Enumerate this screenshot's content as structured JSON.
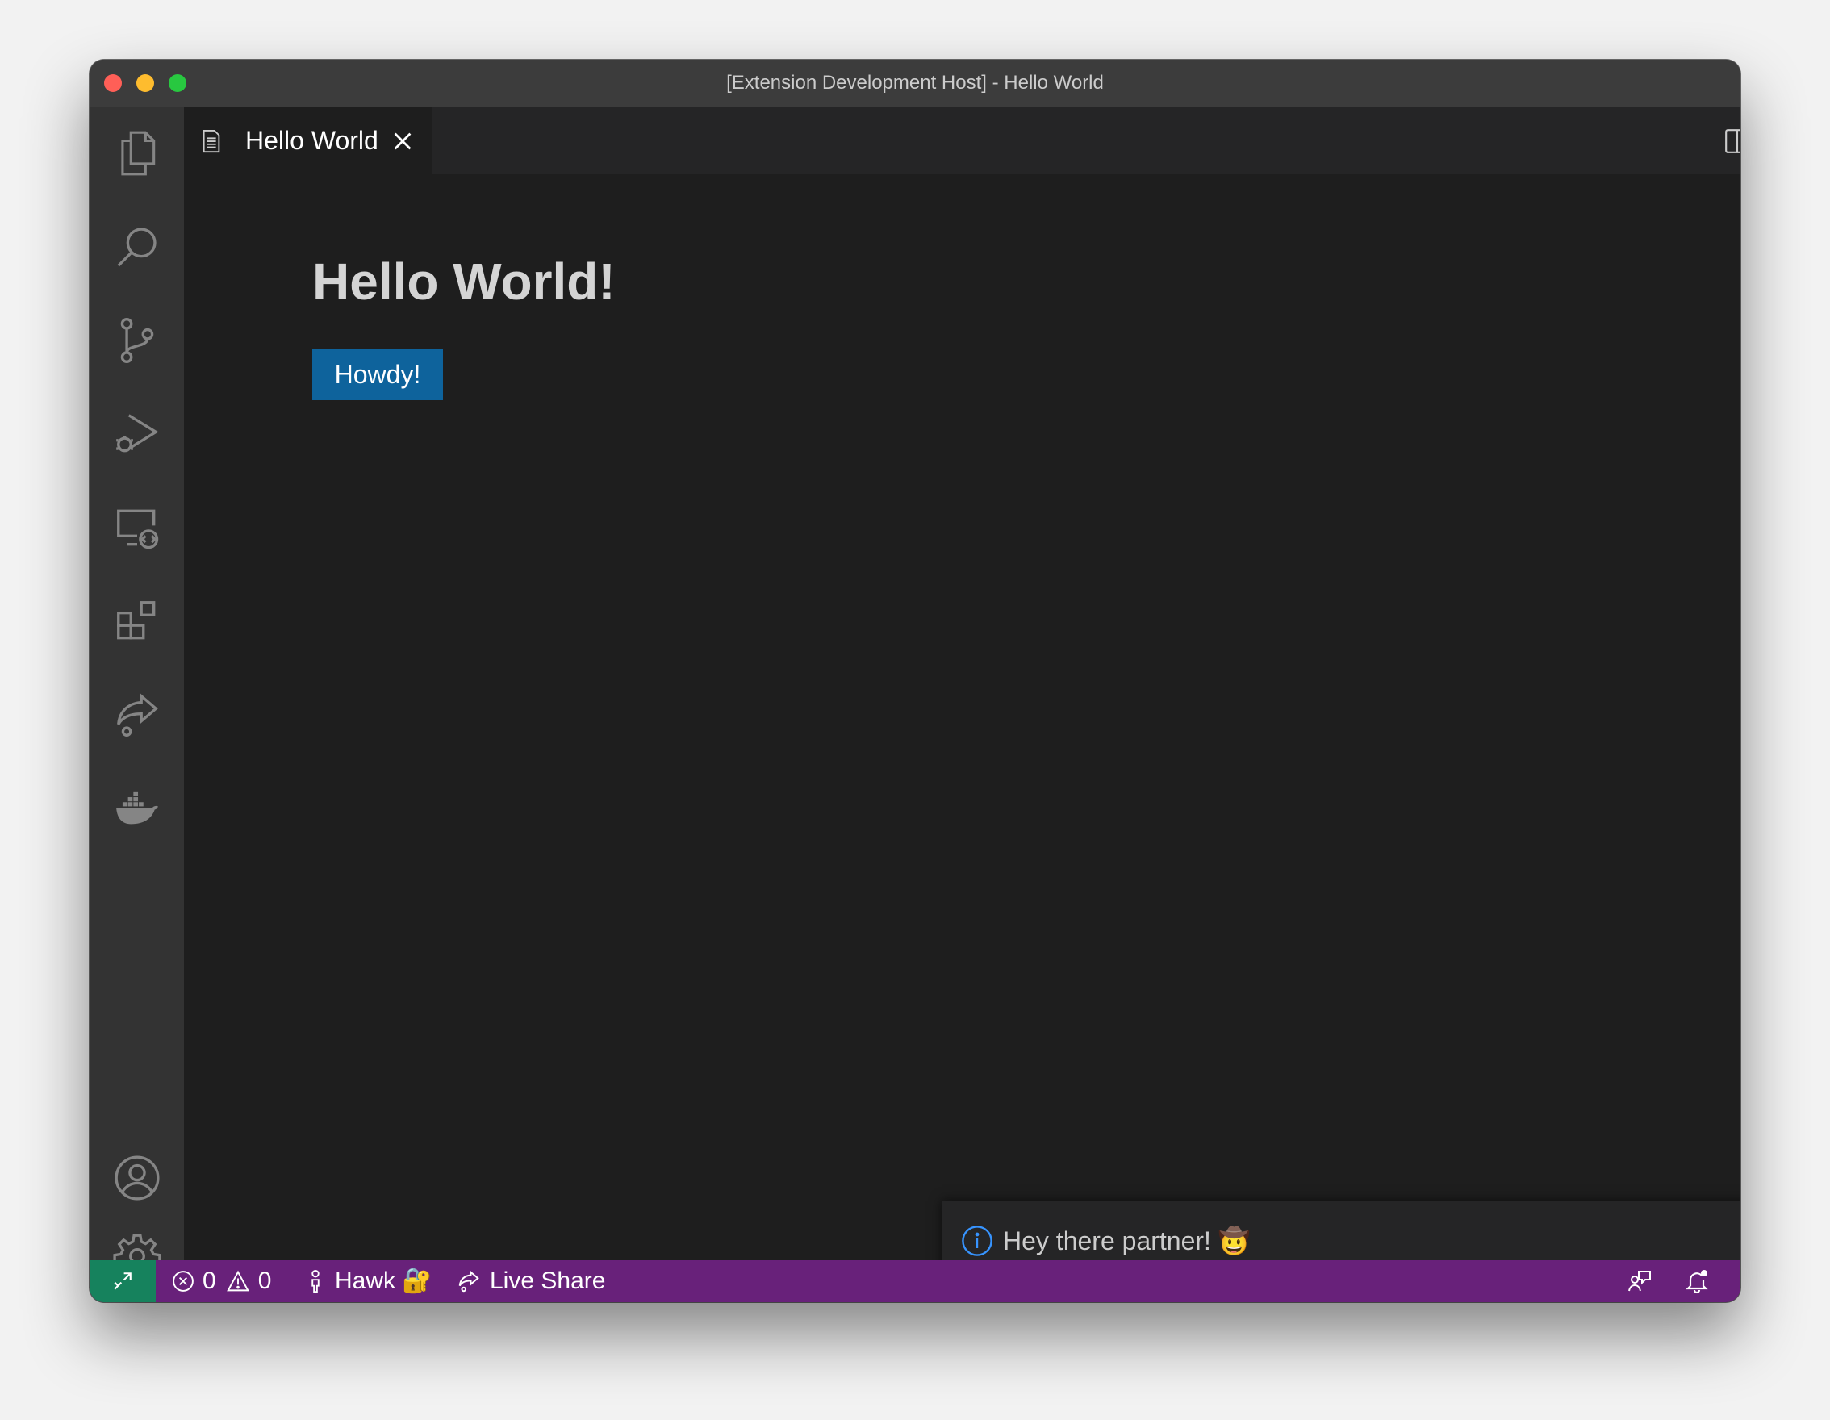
{
  "window": {
    "title": "[Extension Development Host] - Hello World"
  },
  "activity_bar": {
    "items": [
      {
        "icon": "files-icon"
      },
      {
        "icon": "search-icon"
      },
      {
        "icon": "source-control-icon"
      },
      {
        "icon": "run-debug-icon"
      },
      {
        "icon": "remote-explorer-icon"
      },
      {
        "icon": "extensions-icon"
      },
      {
        "icon": "live-share-icon"
      },
      {
        "icon": "docker-icon"
      }
    ],
    "bottom": [
      {
        "icon": "account-icon"
      },
      {
        "icon": "settings-gear-icon"
      }
    ]
  },
  "tab": {
    "label": "Hello World"
  },
  "webview": {
    "heading": "Hello World!",
    "button_label": "Howdy!"
  },
  "notification": {
    "message": "Hey there partner! 🤠"
  },
  "status_bar": {
    "errors": "0",
    "warnings": "0",
    "user": "Hawk 🔐",
    "live_share": "Live Share"
  },
  "colors": {
    "status_bar": "#68217a",
    "remote_indicator": "#16825d",
    "button": "#0e639c",
    "info": "#3794ff"
  }
}
